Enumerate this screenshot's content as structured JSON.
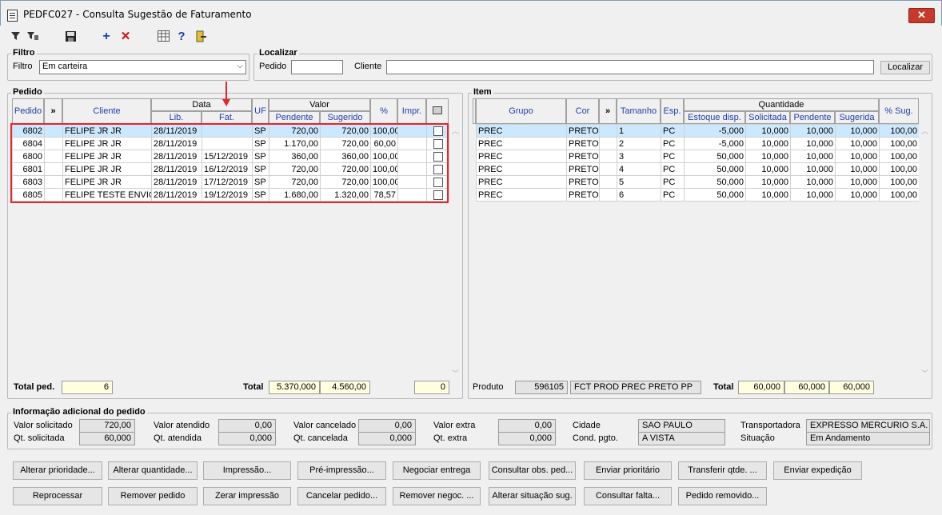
{
  "window": {
    "title": "PEDFC027 - Consulta Sugestão de Faturamento",
    "close_label": "✕"
  },
  "toolbar": {
    "icons": [
      "filter-select-icon",
      "filter-clear-icon",
      "save-icon",
      "add-icon",
      "delete-icon",
      "grid-settings-icon",
      "help-icon",
      "exit-icon"
    ]
  },
  "filtro": {
    "group_label": "Filtro",
    "label": "Filtro",
    "value": "Em carteira"
  },
  "localizar": {
    "group_label": "Localizar",
    "pedido_label": "Pedido",
    "pedido_value": "",
    "cliente_label": "Cliente",
    "cliente_value": "",
    "button": "Localizar"
  },
  "pedido": {
    "group_label": "Pedido",
    "headers": {
      "pedido": "Pedido",
      "expand": "»",
      "cliente": "Cliente",
      "data": "Data",
      "lib": "Lib.",
      "fat": "Fat.",
      "uf": "UF",
      "valor": "Valor",
      "pendente": "Pendente",
      "sugerido": "Sugerido",
      "pct": "%",
      "impr": "Impr."
    },
    "rows": [
      {
        "pedido": "6802",
        "cliente": "FELIPE JR JR",
        "lib": "28/11/2019",
        "fat": "",
        "uf": "SP",
        "pendente": "720,00",
        "sugerido": "720,00",
        "pct": "100,00",
        "impr": ""
      },
      {
        "pedido": "6804",
        "cliente": "FELIPE JR JR",
        "lib": "28/11/2019",
        "fat": "",
        "uf": "SP",
        "pendente": "1.170,00",
        "sugerido": "720,00",
        "pct": "60,00",
        "impr": ""
      },
      {
        "pedido": "6800",
        "cliente": "FELIPE JR JR",
        "lib": "28/11/2019",
        "fat": "15/12/2019",
        "uf": "SP",
        "pendente": "360,00",
        "sugerido": "360,00",
        "pct": "100,00",
        "impr": ""
      },
      {
        "pedido": "6801",
        "cliente": "FELIPE JR JR",
        "lib": "28/11/2019",
        "fat": "16/12/2019",
        "uf": "SP",
        "pendente": "720,00",
        "sugerido": "720,00",
        "pct": "100,00",
        "impr": ""
      },
      {
        "pedido": "6803",
        "cliente": "FELIPE JR JR",
        "lib": "28/11/2019",
        "fat": "17/12/2019",
        "uf": "SP",
        "pendente": "720,00",
        "sugerido": "720,00",
        "pct": "100,00",
        "impr": ""
      },
      {
        "pedido": "6805",
        "cliente": "FELIPE TESTE ENVIO C",
        "lib": "28/11/2019",
        "fat": "19/12/2019",
        "uf": "SP",
        "pendente": "1.680,00",
        "sugerido": "1.320,00",
        "pct": "78,57",
        "impr": ""
      }
    ],
    "total_ped_label": "Total ped.",
    "total_ped_value": "6",
    "total_label": "Total",
    "total_pendente": "5.370,000",
    "total_sugerido": "4.560,00",
    "total_impr": "0"
  },
  "item": {
    "group_label": "Item",
    "headers": {
      "grupo": "Grupo",
      "cor": "Cor",
      "expand": "»",
      "tamanho": "Tamanho",
      "esp": "Esp.",
      "quantidade": "Quantidade",
      "estoque": "Estoque disp.",
      "solicitada": "Solicitada",
      "pendente": "Pendente",
      "sugerida": "Sugerida",
      "pct": "% Sug."
    },
    "rows": [
      {
        "grupo": "PREC",
        "cor": "PRETO",
        "tamanho": "1",
        "esp": "PC",
        "estoque": "-5,000",
        "solicitada": "10,000",
        "pendente": "10,000",
        "sugerida": "10,000",
        "pct": "100,00"
      },
      {
        "grupo": "PREC",
        "cor": "PRETO",
        "tamanho": "2",
        "esp": "PC",
        "estoque": "-5,000",
        "solicitada": "10,000",
        "pendente": "10,000",
        "sugerida": "10,000",
        "pct": "100,00"
      },
      {
        "grupo": "PREC",
        "cor": "PRETO",
        "tamanho": "3",
        "esp": "PC",
        "estoque": "50,000",
        "solicitada": "10,000",
        "pendente": "10,000",
        "sugerida": "10,000",
        "pct": "100,00"
      },
      {
        "grupo": "PREC",
        "cor": "PRETO",
        "tamanho": "4",
        "esp": "PC",
        "estoque": "50,000",
        "solicitada": "10,000",
        "pendente": "10,000",
        "sugerida": "10,000",
        "pct": "100,00"
      },
      {
        "grupo": "PREC",
        "cor": "PRETO",
        "tamanho": "5",
        "esp": "PC",
        "estoque": "50,000",
        "solicitada": "10,000",
        "pendente": "10,000",
        "sugerida": "10,000",
        "pct": "100,00"
      },
      {
        "grupo": "PREC",
        "cor": "PRETO",
        "tamanho": "6",
        "esp": "PC",
        "estoque": "50,000",
        "solicitada": "10,000",
        "pendente": "10,000",
        "sugerida": "10,000",
        "pct": "100,00"
      }
    ],
    "produto_label": "Produto",
    "produto_code": "596105",
    "produto_desc": "FCT PROD PREC PRETO PP",
    "total_label": "Total",
    "total_solicitada": "60,000",
    "total_pendente": "60,000",
    "total_sugerida": "60,000"
  },
  "info": {
    "group_label": "Informação adicional do pedido",
    "valor_solicitado_label": "Valor solicitado",
    "valor_solicitado": "720,00",
    "qt_solicitada_label": "Qt. solicitada",
    "qt_solicitada": "60,000",
    "valor_atendido_label": "Valor atendido",
    "valor_atendido": "0,00",
    "qt_atendida_label": "Qt. atendida",
    "qt_atendida": "0,000",
    "valor_cancelado_label": "Valor cancelado",
    "valor_cancelado": "0,00",
    "qt_cancelada_label": "Qt. cancelada",
    "qt_cancelada": "0,000",
    "valor_extra_label": "Valor extra",
    "valor_extra": "0,00",
    "qt_extra_label": "Qt. extra",
    "qt_extra": "0,000",
    "cidade_label": "Cidade",
    "cidade": "SAO PAULO",
    "cond_pgto_label": "Cond. pgto.",
    "cond_pgto": "A VISTA",
    "transportadora_label": "Transportadora",
    "transportadora": "EXPRESSO MERCURIO S.A.",
    "situacao_label": "Situação",
    "situacao": "Em Andamento"
  },
  "buttons": {
    "row1": [
      "Alterar prioridade...",
      "Alterar quantidade...",
      "Impressão...",
      "Pré-impressão...",
      "Negociar entrega",
      "Consultar obs. ped...",
      "Enviar prioritário",
      "Transferir qtde. ...",
      "Enviar expedição"
    ],
    "row2": [
      "Reprocessar",
      "Remover pedido",
      "Zerar impressão",
      "Cancelar pedido...",
      "Remover negoc. ...",
      "Alterar situação sug.",
      "Consultar falta...",
      "Pedido removido..."
    ]
  },
  "colors": {
    "highlight": "#e8232a",
    "yellow": "#ffffdf",
    "selected_row": "#cce8ff"
  }
}
